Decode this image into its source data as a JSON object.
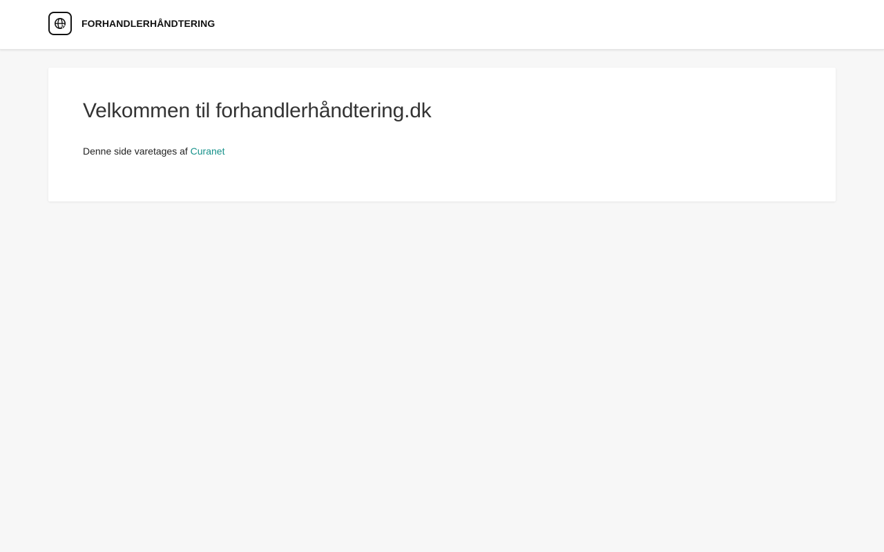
{
  "header": {
    "brand_name": "FORHANDLERHÅNDTERING",
    "logo_icon": "globe-icon"
  },
  "main": {
    "title": "Velkommen til forhandlerhåndtering.dk",
    "maintained_prefix": "Denne side varetages af",
    "maintained_link": "Curanet"
  },
  "colors": {
    "page_background": "#f7f7f7",
    "card_background": "#ffffff",
    "link": "#15918a"
  }
}
